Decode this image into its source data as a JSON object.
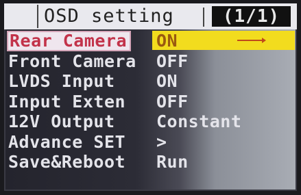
{
  "header": {
    "title": "OSD setting",
    "page": "(1/1)"
  },
  "menu": {
    "items": [
      {
        "label": "Rear Camera",
        "value": "ON"
      },
      {
        "label": "Front Camera",
        "value": "OFF"
      },
      {
        "label": "LVDS Input",
        "value": "ON"
      },
      {
        "label": "Input Exten",
        "value": "OFF"
      },
      {
        "label": "12V Output",
        "value": "Constant"
      },
      {
        "label": "Advance SET",
        "value": ">"
      },
      {
        "label": "Save&Reboot",
        "value": "Run"
      }
    ]
  },
  "colors": {
    "highlight": "#f2dc1e",
    "selected_label": "#c2334a",
    "menu_text": "#e4e4ea"
  },
  "icons": {
    "selection_indicator": "arrow-right-icon"
  }
}
